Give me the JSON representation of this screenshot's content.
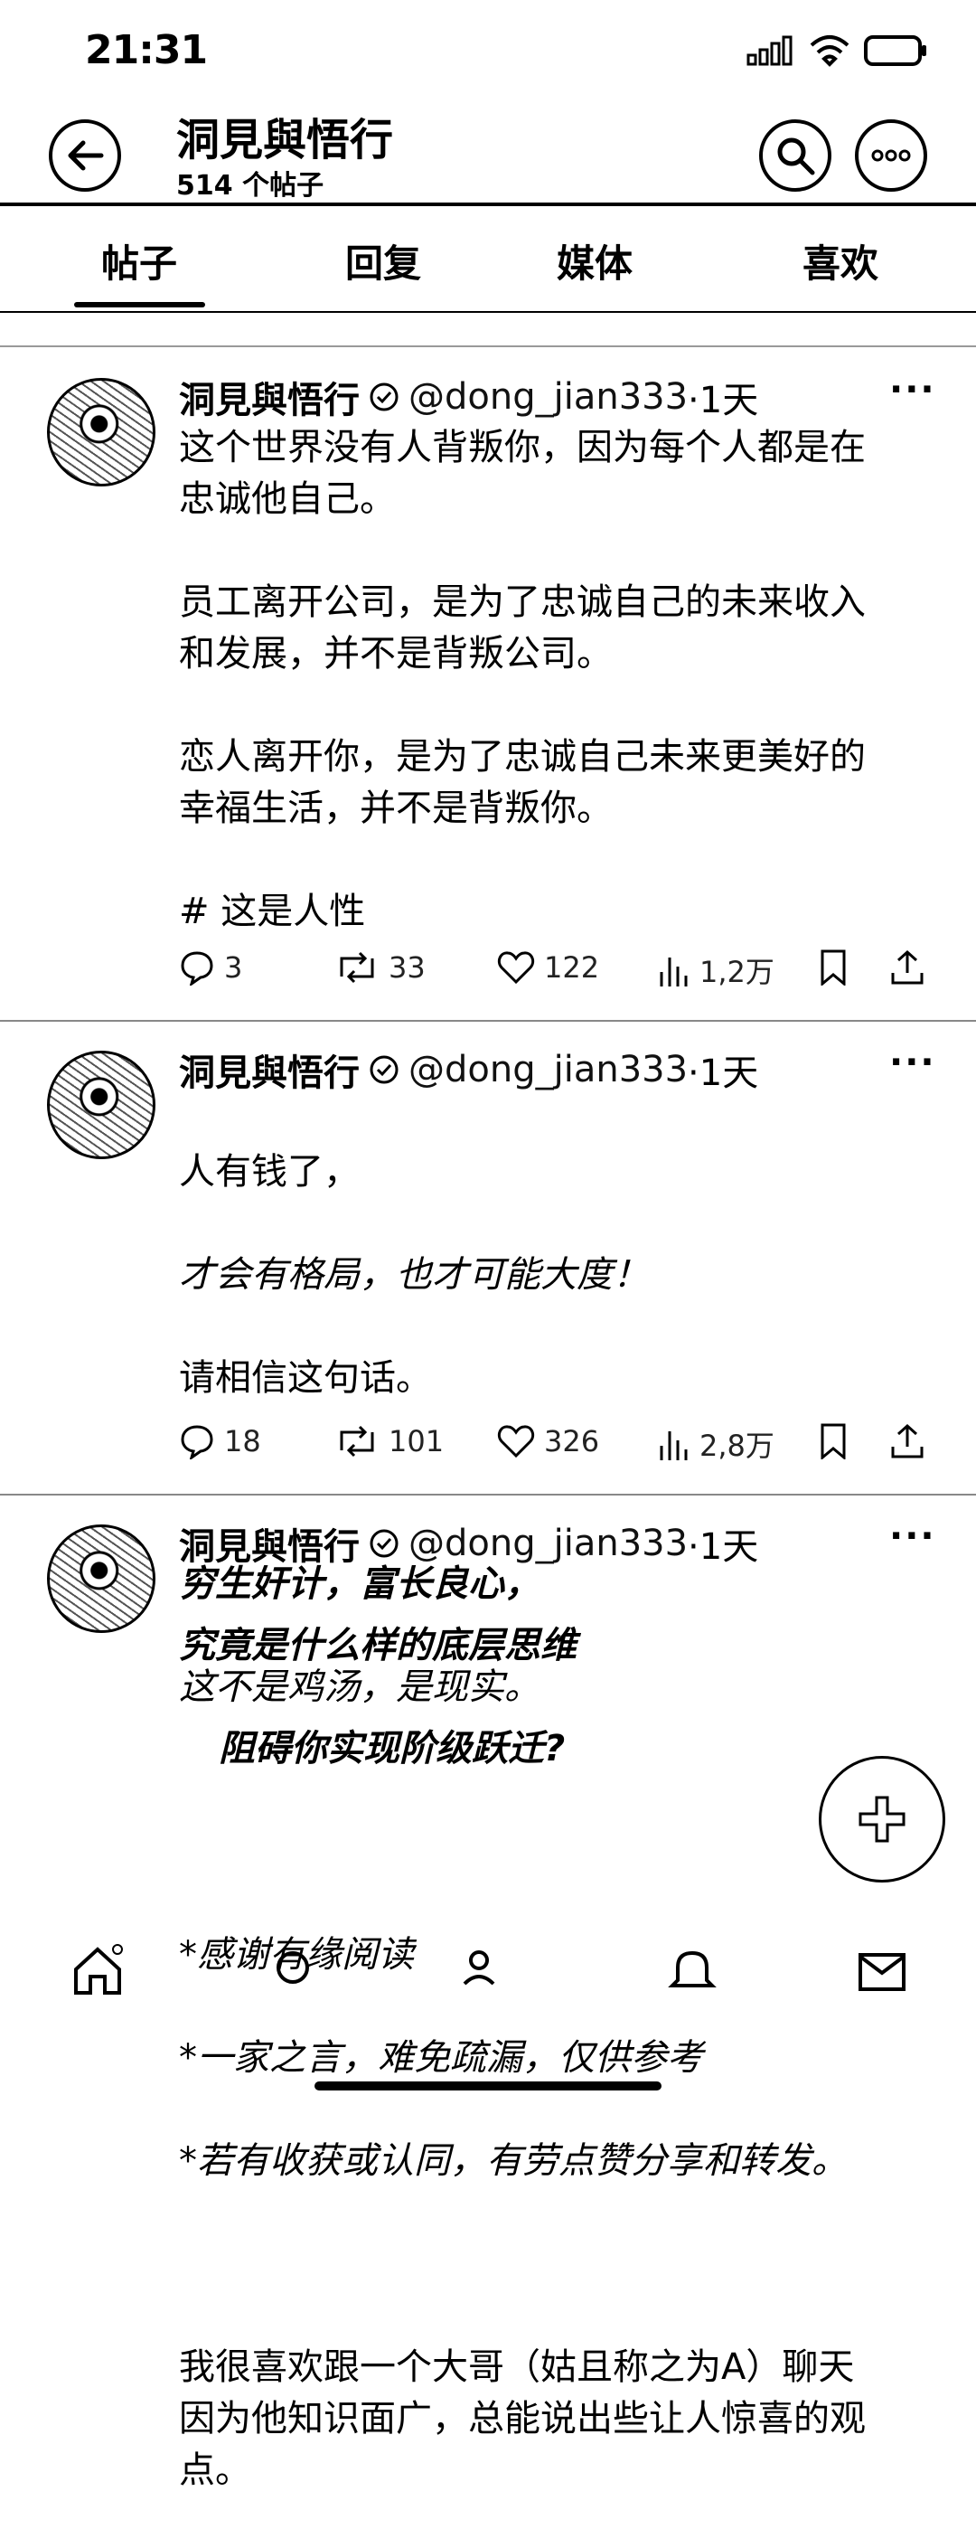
{
  "status": {
    "time": "21:31"
  },
  "header": {
    "title": "洞見與悟行",
    "subtitle": "514 个帖子"
  },
  "tabs": [
    {
      "label": "帖子"
    },
    {
      "label": "回复"
    },
    {
      "label": "媒体"
    },
    {
      "label": "喜欢"
    }
  ],
  "posts": [
    {
      "author": "洞見與悟行",
      "handle": "@dong_jian333",
      "time": "·1天",
      "body": "这个世界没有人背叛你，因为每个人都是在\n忠诚他自己。\n\n员工离开公司，是为了忠诚自己的未来收入\n和发展，并不是背叛公司。\n\n恋人离开你，是为了忠诚自己未来更美好的\n幸福生活，并不是背叛你。\n\n # 这是人性",
      "replies": "3",
      "reposts": "33",
      "likes": "122",
      "views": "1,2万"
    },
    {
      "author": "洞見與悟行",
      "handle": "@dong_jian333",
      "time": "·1天",
      "body1": "人有钱了，",
      "body2": "才会有格局，也才可能大度！",
      "body3": "请相信这句话。",
      "body4": "穷生奸计，富长良心，",
      "body5": "这不是鸡汤，是现实。",
      "replies": "18",
      "reposts": "101",
      "likes": "326",
      "views": "2,8万"
    },
    {
      "author": "洞見與悟行",
      "handle": "@dong_jian333",
      "time": "·1天",
      "title1": "究竟是什么样的底层思维",
      "title2": "阻碍你实现阶级跃迁?",
      "note1": "*感谢有缘阅读",
      "note2": "*一家之言，难免疏漏，仅供参考",
      "note3": "*若有收获或认同，有劳点赞分享和转发。",
      "body": "我很喜欢跟一个大哥（姑且称之为A）聊天\n因为他知识面广，总能说出些让人惊喜的观\n点。"
    }
  ]
}
